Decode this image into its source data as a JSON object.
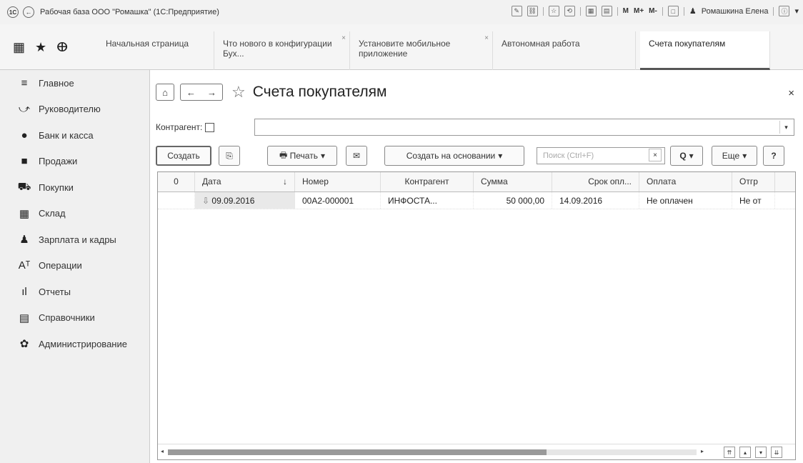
{
  "titlebar": {
    "logo_text": "1С",
    "back_symbol": "←",
    "title": "Рабочая база ООО \"Ромашка\"  (1С:Предприятие)",
    "mem_buttons": [
      "M",
      "M+",
      "M-"
    ],
    "user_name": "Ромашкина Елена",
    "icons": [
      "edit-icon",
      "link-icon",
      "favorites-icon",
      "history-icon",
      "calendar-icon",
      "calc-icon",
      "window-icon",
      "user-icon",
      "info-icon"
    ]
  },
  "tabs": [
    {
      "label": "Начальная страница"
    },
    {
      "label": "Что нового в конфигурации Бух...",
      "close": "×"
    },
    {
      "label": "Установите мобильное приложение",
      "close": "×"
    },
    {
      "label": "Автономная работа"
    },
    {
      "label": "Счета покупателям"
    }
  ],
  "tabs_icons": {
    "grid": "▦",
    "star": "★",
    "history": "ⴲ"
  },
  "sidebar": {
    "items": [
      {
        "label": "Главное",
        "icon": "≡"
      },
      {
        "label": "Руководителю",
        "icon": "⤻"
      },
      {
        "label": "Банк и касса",
        "icon": "●"
      },
      {
        "label": "Продажи",
        "icon": "■"
      },
      {
        "label": "Покупки",
        "icon": "⛟"
      },
      {
        "label": "Склад",
        "icon": "▦"
      },
      {
        "label": "Зарплата и кадры",
        "icon": "♟"
      },
      {
        "label": "Операции",
        "icon": "Aᵀ"
      },
      {
        "label": "Отчеты",
        "icon": "ıl"
      },
      {
        "label": "Справочники",
        "icon": "▤"
      },
      {
        "label": "Администрирование",
        "icon": "✿"
      }
    ]
  },
  "form": {
    "title": "Счета покупателям",
    "home_icon": "⌂",
    "back_icon": "←",
    "forward_icon": "→",
    "star_icon": "☆",
    "close_icon": "×",
    "counterparty_label": "Контрагент:",
    "counterparty_value": "",
    "dropdown_icon": "▾"
  },
  "toolbar": {
    "create_label": "Создать",
    "copy_icon": "⎘",
    "print_label": "Печать",
    "mail_icon": "✉",
    "create_based_label": "Создать на основании",
    "search_placeholder": "Поиск (Ctrl+F)",
    "search_clear": "×",
    "search_icon": "Q",
    "more_label": "Еще",
    "help_label": "?",
    "caret": "▾"
  },
  "table": {
    "columns": [
      "",
      "Дата",
      "Номер",
      "Контрагент",
      "Сумма",
      "Срок опл...",
      "Оплата",
      "Отгр"
    ],
    "sort_indicator": "↓",
    "attach_icon": "0",
    "rows": [
      {
        "attach": "",
        "date": "09.09.2016",
        "number": "00А2-000001",
        "counterparty": "ИНФОСТА...",
        "sum": "50 000,00",
        "due": "14.09.2016",
        "payment": "Не оплачен",
        "shipment": "Не от"
      }
    ]
  }
}
